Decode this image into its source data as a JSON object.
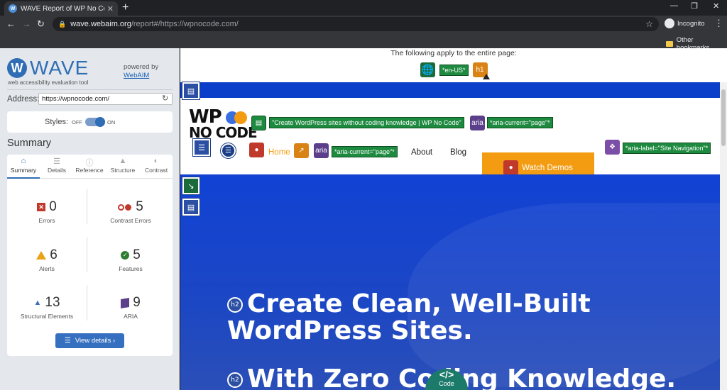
{
  "browser": {
    "tab_title": "WAVE Report of WP No Code – N",
    "favicon_letter": "W",
    "close": "✕",
    "new_tab": "+",
    "url_host": "wave.webaim.org",
    "url_path": "/report#/https://wpnocode.com/",
    "profile": "Incognito",
    "other_bookmarks": "Other bookmarks"
  },
  "wave": {
    "logo_letter": "W",
    "logo_text": "WAVE",
    "tagline": "web accessibility evaluation tool",
    "powered_by": "powered by",
    "powered_link": "WebAIM",
    "address_label": "Address:",
    "address_value": "https://wpnocode.com/",
    "styles_label": "Styles:",
    "styles_off": "OFF",
    "styles_on": "ON",
    "summary_heading": "Summary",
    "tabs": [
      {
        "label": "Summary",
        "icon": "home-icon"
      },
      {
        "label": "Details",
        "icon": "list-icon"
      },
      {
        "label": "Reference",
        "icon": "info-icon"
      },
      {
        "label": "Structure",
        "icon": "structure-icon"
      },
      {
        "label": "Contrast",
        "icon": "contrast-icon"
      }
    ],
    "stats": {
      "errors": {
        "count": "0",
        "label": "Errors"
      },
      "contrast": {
        "count": "5",
        "label": "Contrast Errors"
      },
      "alerts": {
        "count": "6",
        "label": "Alerts"
      },
      "features": {
        "count": "5",
        "label": "Features"
      },
      "structural": {
        "count": "13",
        "label": "Structural Elements"
      },
      "aria": {
        "count": "9",
        "label": "ARIA"
      }
    },
    "view_details": "View details ›"
  },
  "report": {
    "applies_text": "The following apply to the entire page:",
    "lang_tag": "*en-US*",
    "h1_label": "h1",
    "site_alt": "\"Create WordPress sites without coding knowledge | WP No Code\"",
    "aria_label": "aria",
    "aria_current_1": "*aria-current=\"page\"*",
    "aria_current_2": "*aria-current=\"page\"*",
    "aria_label_nav": "*aria-label=\"Site Navigation\"*",
    "logo_wp": "WP",
    "logo_nc": "NO CODE",
    "nav": {
      "home": "Home",
      "about": "About",
      "blog": "Blog",
      "watch": "Watch Demos"
    },
    "h2_badge": "h2",
    "hero_line1": "Create Clean, Well-Built",
    "hero_line2": "WordPress Sites.",
    "hero_line3": "With Zero Coding Knowledge.",
    "code_btn_icon": "</>",
    "code_btn_label": "Code"
  },
  "colors": {
    "wave_blue": "#2f6db5",
    "hero_blue": "#1142d4",
    "feature_green": "#1d8a3f",
    "watch_orange": "#f39c12",
    "error_red": "#c0392b",
    "aria_purple": "#5b3f8a"
  }
}
